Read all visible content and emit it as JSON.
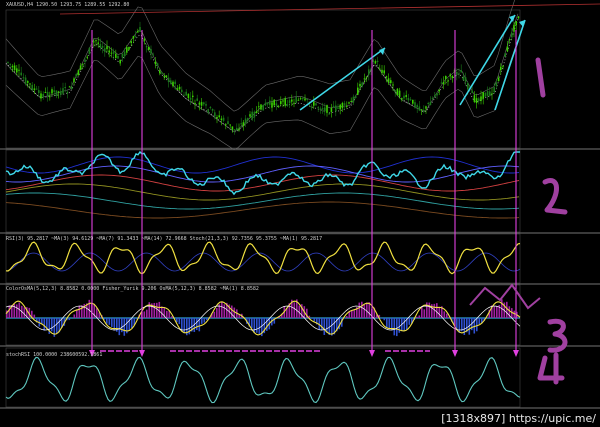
{
  "colors": {
    "background": "#000000",
    "bull_candle": "#39d000",
    "bear_candle": "#1a7a1a",
    "accent_magenta": "#e040e0",
    "arrow_cyan": "#3fd8e8",
    "momentum_yellow": "#f0e040",
    "stoch_teal": "#5fc8c0",
    "divider": "#9a9a9a",
    "annotation_purple": "#a040a0"
  },
  "panel1": {
    "header": "XAUUSD,H4  1290.50 1293.75 1289.55 1292.80",
    "annotation": "1"
  },
  "panel2": {
    "header": "",
    "annotation": "2"
  },
  "panel3": {
    "header": "RSI(3) 95.2817   ~MA(3) 94.6129  ~MA(7) 91.3433  ~MA(14) 72.9668  Stoch(21,3,3) 92.7356 95.3755  ~MA(1) 95.2817"
  },
  "panel4": {
    "header": "ColorOsMA(5,12,3) 8.8582 0.0000   Fisher_Yurik 9.206  OsMA(5,12,3) 8.8582  ~MA(1) 8.8582",
    "annotation": "3"
  },
  "panel5": {
    "header": "stochRSI 100.0000 238600592.1861",
    "annotation": "4"
  },
  "footer": "[1318x897] https://upic.me/"
}
